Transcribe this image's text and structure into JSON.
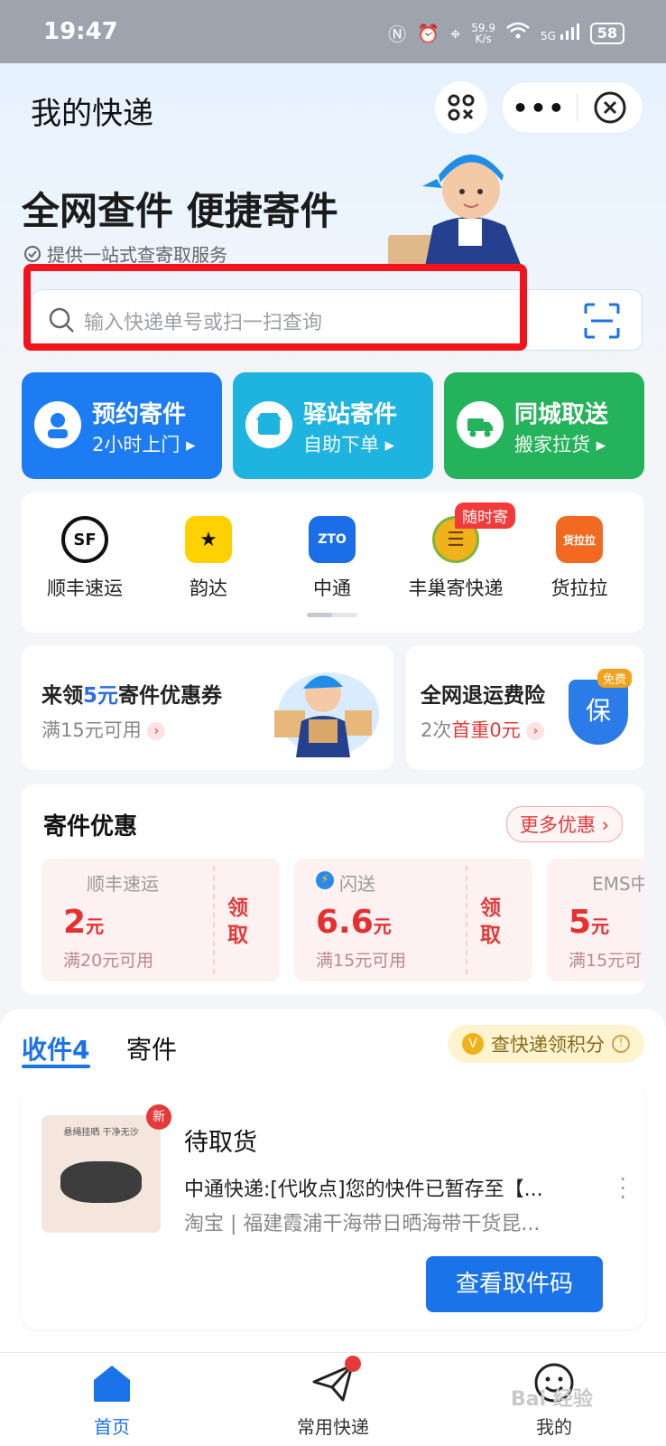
{
  "status_bar": {
    "time": "19:47",
    "net_speed": "59.9",
    "net_unit": "K/s",
    "network": "5G",
    "battery": "58"
  },
  "header": {
    "title": "我的快递",
    "more_label": "•••"
  },
  "hero": {
    "headline": "全网查件 便捷寄件",
    "subtitle": "提供一站式查寄取服务"
  },
  "search": {
    "placeholder": "输入快递单号或扫一扫查询"
  },
  "services": [
    {
      "title": "预约寄件",
      "subtitle": "2小时上门 ▸",
      "color": "#1e7cf2"
    },
    {
      "title": "驿站寄件",
      "subtitle": "自助下单 ▸",
      "color": "#1fb3e0"
    },
    {
      "title": "同城取送",
      "subtitle": "搬家拉货 ▸",
      "color": "#24b35a"
    }
  ],
  "couriers": [
    {
      "name": "顺丰速运",
      "logo_text": "SF",
      "icon": "sf-logo-icon"
    },
    {
      "name": "韵达",
      "logo_text": "★",
      "icon": "yunda-logo-icon"
    },
    {
      "name": "中通",
      "logo_text": "ZTO",
      "icon": "zto-logo-icon"
    },
    {
      "name": "丰巢寄快递",
      "logo_text": "☰",
      "icon": "fengchao-logo-icon"
    },
    {
      "name": "货拉拉",
      "logo_text": "货拉拉",
      "icon": "huolala-logo-icon"
    }
  ],
  "courier_badge": "随时寄",
  "promos": {
    "coupon_title_a": "来领",
    "coupon_title_amount": "5元",
    "coupon_title_b": "寄件优惠券",
    "coupon_sub": "满15元可用",
    "insurance_title": "全网退运费险",
    "insurance_sub_a": "2次",
    "insurance_sub_b": "首重0元",
    "insurance_badge": "免费",
    "insurance_shield": "保"
  },
  "deals": {
    "title": "寄件优惠",
    "more": "更多优惠 ›",
    "coupons": [
      {
        "brand": "顺丰速运",
        "amount": "2",
        "unit": "元",
        "condition": "满20元可用",
        "action": "领取"
      },
      {
        "brand": "闪送",
        "amount": "6.6",
        "unit": "元",
        "condition": "满15元可用",
        "action": "领取"
      },
      {
        "brand": "EMS中",
        "amount": "5",
        "unit": "元",
        "condition": "满15元可",
        "action": ""
      }
    ]
  },
  "tabs": {
    "receive": "收件4",
    "send": "寄件",
    "points": "查快递领积分"
  },
  "parcel": {
    "badge": "新",
    "thumb_text": "悬绳挂晒 干净无沙",
    "status": "待取货",
    "line1": "中通快递:[代收点]您的快件已暂存至【...",
    "line2": "淘宝 | 福建霞浦干海带日晒海带干货昆...",
    "cta": "查看取件码"
  },
  "bottom_nav": [
    {
      "label": "首页",
      "icon": "home-icon",
      "active": true
    },
    {
      "label": "常用快递",
      "icon": "paper-plane-icon",
      "active": false
    },
    {
      "label": "我的",
      "icon": "smiley-icon",
      "active": false
    }
  ],
  "watermark": "Bai 经验"
}
